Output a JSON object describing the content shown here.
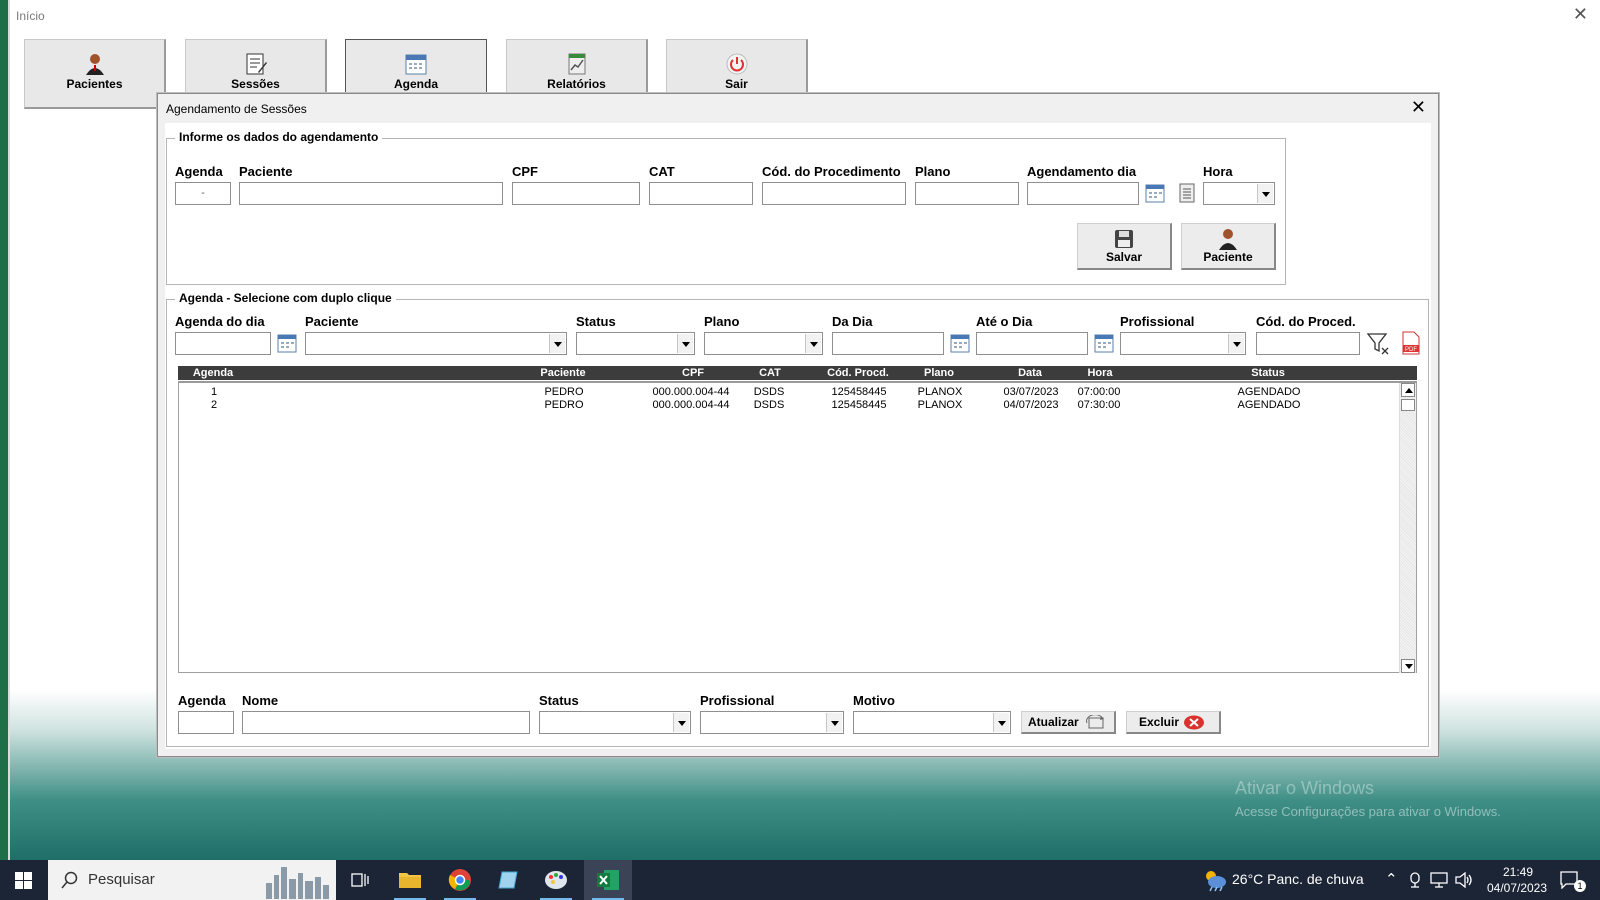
{
  "window": {
    "title": "Início",
    "close_glyph": "✕"
  },
  "nav": [
    {
      "label": "Pacientes",
      "icon": "person-icon"
    },
    {
      "label": "Sessões",
      "icon": "notes-icon"
    },
    {
      "label": "Agenda",
      "icon": "calendar-icon"
    },
    {
      "label": "Relatórios",
      "icon": "chart-icon"
    },
    {
      "label": "Sair",
      "icon": "power-icon"
    }
  ],
  "dialog": {
    "title": "Agendamento de Sessões",
    "close_glyph": "✕",
    "form": {
      "group_title": "Informe os dados do agendamento",
      "labels": {
        "agenda": "Agenda",
        "paciente": "Paciente",
        "cpf": "CPF",
        "cat": "CAT",
        "cod_proc": "Cód. do Procedimento",
        "plano": "Plano",
        "agendamento_dia": "Agendamento dia",
        "hora": "Hora"
      },
      "values": {
        "agenda": "-",
        "paciente": "",
        "cpf": "",
        "cat": "",
        "cod_proc": "",
        "plano": "",
        "agendamento_dia": "",
        "hora": ""
      },
      "buttons": {
        "salvar": "Salvar",
        "paciente": "Paciente"
      }
    },
    "filter": {
      "group_title": "Agenda - Selecione com duplo clique",
      "labels": {
        "agenda_dia": "Agenda do dia",
        "paciente": "Paciente",
        "status": "Status",
        "plano": "Plano",
        "da_dia": "Da Dia",
        "ate_dia": "Até o Dia",
        "profissional": "Profissional",
        "cod_proc": "Cód. do Proced."
      }
    },
    "list": {
      "columns": [
        "Agenda",
        "Paciente",
        "CPF",
        "CAT",
        "Cód. Procd.",
        "Plano",
        "Data",
        "Hora",
        "Status"
      ],
      "rows": [
        [
          "1",
          "PEDRO",
          "000.000.004-44",
          "DSDS",
          "125458445",
          "PLANOX",
          "03/07/2023",
          "07:00:00",
          "AGENDADO"
        ],
        [
          "2",
          "PEDRO",
          "000.000.004-44",
          "DSDS",
          "125458445",
          "PLANOX",
          "04/07/2023",
          "07:30:00",
          "AGENDADO"
        ]
      ]
    },
    "edit": {
      "labels": {
        "agenda": "Agenda",
        "nome": "Nome",
        "status": "Status",
        "profissional": "Profissional",
        "motivo": "Motivo"
      },
      "buttons": {
        "atualizar": "Atualizar",
        "excluir": "Excluir"
      }
    }
  },
  "watermark": {
    "line1": "Ativar o Windows",
    "line2": "Acesse Configurações para ativar o Windows."
  },
  "taskbar": {
    "search_placeholder": "Pesquisar",
    "weather": "26°C  Panc. de chuva",
    "time": "21:49",
    "date": "04/07/2023",
    "notifications": "1"
  },
  "colors": {
    "excel_green": "#1e6e47",
    "taskbar": "#1b2535",
    "list_header": "#3c3c3c"
  }
}
